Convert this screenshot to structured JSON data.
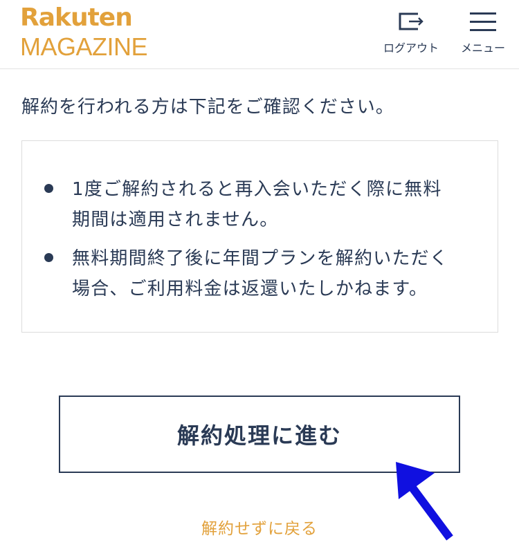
{
  "header": {
    "logo_line1": "Rakuten",
    "logo_line2": "MAGAZINE",
    "logout_label": "ログアウト",
    "menu_label": "メニュー"
  },
  "main": {
    "intro": "解約を行われる方は下記をご確認ください。",
    "notices": [
      "1度ご解約されると再入会いただく際に無料期間は適用されません。",
      "無料期間終了後に年間プランを解約いただく場合、ご利用料金は返還いたしかねます。"
    ],
    "proceed_label": "解約処理に進む",
    "cancel_label": "解約せずに戻る"
  },
  "colors": {
    "brand": "#e2a13b",
    "text": "#2a3a55",
    "annotation_arrow": "#1010e0"
  },
  "icons": [
    "logout-icon",
    "hamburger-menu-icon",
    "bullet-icon",
    "annotation-arrow-icon"
  ]
}
